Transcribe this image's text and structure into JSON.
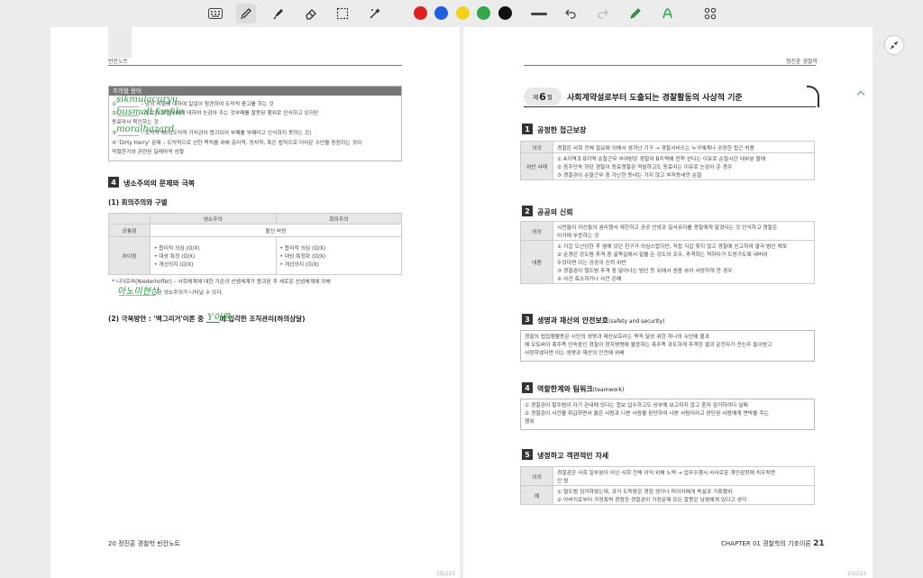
{
  "toolbar": {
    "tools": [
      "keyboard-icon",
      "pen-icon",
      "highlighter-icon",
      "eraser-icon",
      "lasso-select-icon",
      "ai-magic-icon"
    ],
    "colors": [
      "#e02020",
      "#1f5fe0",
      "#f2d21b",
      "#2ea84a",
      "#111111"
    ],
    "actions": [
      "undo-icon",
      "redo-icon",
      "pen-settings-icon",
      "shape-recognition-icon",
      "grid-menu-icon"
    ]
  },
  "left_page": {
    "header": "빈칸노트",
    "caution": {
      "title": "주의할 용어",
      "lines": [
        "① ________ – 남의 비행에 대하여 일일이 참견하여 도덕적 충고를 하는 것",
        "② ________ – 동료의 부정부패에 대하여 눈감아 주는 것부패를 잘못된 행위로 인식하고 있지만",
        "   동료라서 묵인하는 것",
        "③ ________ – 도덕적 해이(도덕적 가치관이 붕괴되어 부패를 부패라고 인식하지 못하는 것)",
        "④ 'Dirty Harry' 문제 – 도덕적으로 선한 목적을 위해 윤리적, 정치적, 혹은 법적으로 더러운 수단을 동원하는 것이",
        "   적절한가와 관련된 딜레마적 상황"
      ],
      "handwriting": [
        "sikmulacuryu",
        "busmall fanfile",
        "moralhazard"
      ]
    },
    "section4": {
      "num": "4",
      "title": "냉소주의의 문제와 극복",
      "sub1": "(1) 회의주의와 구별",
      "table": {
        "col1": "냉소주의",
        "col2": "회의주의",
        "common_label": "공통점",
        "common_value": "불신 바탕",
        "diff_label": "차이점",
        "left_items": [
          "• 합리적 의심 (O/X)",
          "• 대상 특정 (O/X)",
          "• 개선의지 (O/X)"
        ],
        "right_items": [
          "• 합리적 의심 (O/X)",
          "• 대상 특정화 (O/X)",
          "• 개선의지 (O/X)"
        ]
      },
      "note1": "* 니더호퍼(Niederhoffer) – 사회체계에 대한 기존의 신념체계가 붕괴된 후 새로운 신념체계에 의해",
      "note2": "______________ 된 냉소주의가 나타날 수 있다.",
      "note_hand": "아노미현상",
      "sub2": "(2) 극복방안 : '맥그리거'이론 중 ____에 입각한 조직관리(하의상달)",
      "sub2_hand": "Y이론"
    },
    "footer": "20  정진훈 경찰학 빈칸노트",
    "page_count": "19/223"
  },
  "right_page": {
    "header": "정진훈 경찰학",
    "chapter_label": "제",
    "chapter_num": "6",
    "chapter_suffix": "절",
    "chapter_title": "사회계약설로부터 도출되는 경찰활동의 사상적 기준",
    "sections": [
      {
        "num": "1",
        "title": "공정한 접근보장",
        "rows": [
          {
            "label": "의의",
            "lines": [
              "경찰은 사회 전체 필요에 의해서 생겨난 기구 → 경찰서비스는 누구에게나 공정한 접근 허용"
            ]
          },
          {
            "label": "위반 사례",
            "lines": [
              "① A지역과 B지역 순찰근무 부여받은 경찰이 B지역에 친척 산다는 이유로 순찰시간 대부분 할애",
              "② 음주단속 하던 경찰이 동료경찰관 적발하고도 동료라는 이유로 눈감아 준 경우",
              "③ 경찰관이 순찰근무 중 가난한 동네는 가지 않고 부자동네만 순찰"
            ]
          }
        ]
      },
      {
        "num": "2",
        "title": "공공의 신뢰",
        "rows": [
          {
            "label": "의의",
            "lines": [
              "시민들이 자신들의 권리행사 제한하고 공공 안녕과 질서유지를 경찰에게 맡겼다는 것 인식하고 경찰은",
              "이거에 부응하는 것"
            ]
          },
          {
            "label": "내용",
            "lines": [
              "① 지갑 도난당한 후 옆에 있던 친구가 의심스럽지만, 직접 지갑 찾지 않고 경찰에 신고하여 결국 범인 체포",
              "② 순경은 강도범 추격 중 골목길에서 칼을 든 강도와 조우, 추격하는 척하다가 도망가도록 내버려",
              "    두었다면 이는 공공의 신뢰 위반",
              "③ 경찰관이 절도범 추격 중 달아나는 범인 등 뒤에서 권총 쏘아 사망하게 한 경우",
              "④ 사건 축소하거나 사건 은폐"
            ]
          }
        ]
      },
      {
        "num": "3",
        "title": "생명과 재산의 안전보호",
        "title_suffix": "(safety and security)",
        "lines": [
          "경찰의 법집행활동은 시민의 생명과 재산보호라는 목적 달성 위한 하나의 수단에 불과",
          "예 오토바이 폭주족 단속중인 경찰이 정지명령에 불응하는 폭주족 과도하게 추격한 결과 운전자가 전신주 들이받고",
          "    사망하였다면 이는 생명과 재산의 안전에 위배"
        ]
      },
      {
        "num": "4",
        "title": "역할한계와 팀워크",
        "title_suffix": "(teamwork)",
        "lines": [
          "① 경찰관이 탈주범이 자기 관내에 있다는 첩보 입수하고도 상부에 보고하지 않고 혼자 검거하려다 실패",
          "② 경찰관이 사건을 취급하면서 옳은 사람과 나쁜 사람을 판단하여 나쁜 사람이라고 판단된 사람에게 면박을 주는",
          "    행위"
        ]
      },
      {
        "num": "5",
        "title": "냉정하고 객관적인 자세",
        "rows": [
          {
            "label": "의의",
            "lines": [
              "경찰관은 사회 일부분이 아닌 사회 전체 이익 위해 노력 → 업무수행시 사사로운 개인감정에 치우치면",
              "안 됨"
            ]
          },
          {
            "label": "예",
            "lines": [
              "① 절도범 검거하였는데, 과거 도둑맞은 경험 생각나 피의자에게 욕설과 가혹행위",
              "② 아버지로부터 가정폭력 경험한 경찰관이 가정문제 모든 잘못은 남편에게 있다고 생각"
            ]
          }
        ]
      }
    ],
    "footer_left": "CHAPTER 01  경찰학의 기초이론",
    "footer_num": "21",
    "page_count": "20/223"
  }
}
